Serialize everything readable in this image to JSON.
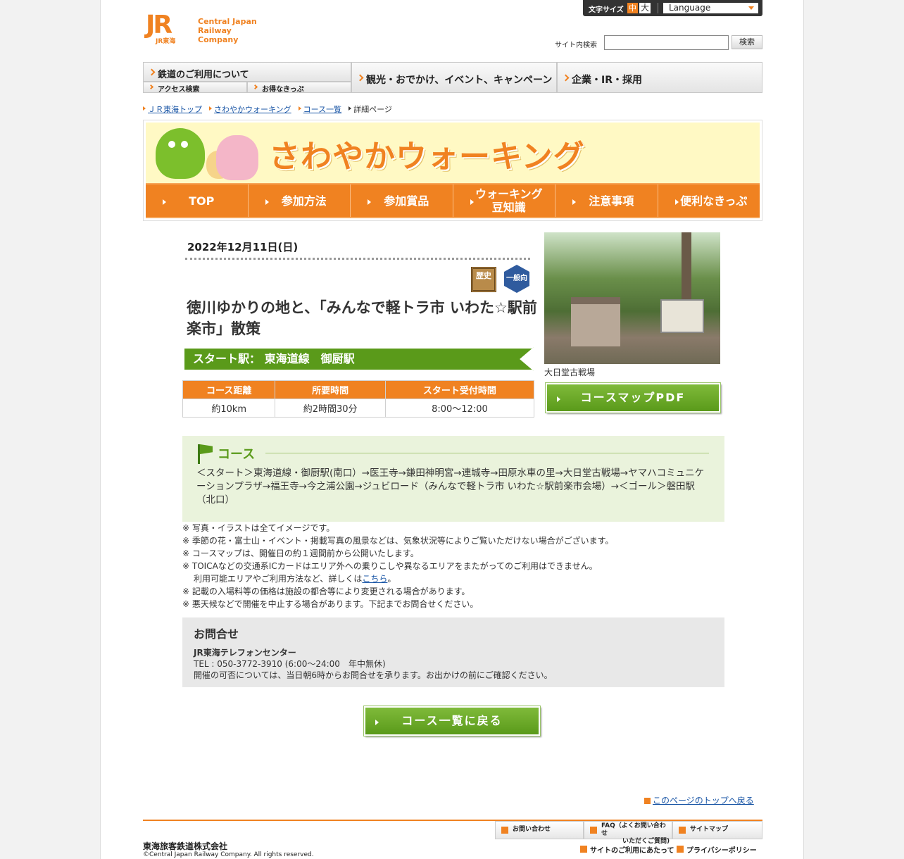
{
  "header": {
    "company_en_line1": "Central Japan",
    "company_en_line2": "Railway Company",
    "logo_mark": "JR",
    "logo_sub": "JR東海",
    "font_size_label": "文字サイズ",
    "font_medium": "中",
    "font_large": "大",
    "language_label": "Language",
    "search_label": "サイト内検索",
    "search_button": "検索",
    "search_value": ""
  },
  "global_nav": {
    "railway": "鉄道のご利用について",
    "access": "アクセス検索",
    "tickets": "お得なきっぷ",
    "tourism": "観光・おでかけ、イベント、キャンペーン",
    "corporate": "企業・IR・採用"
  },
  "breadcrumb": [
    "ＪＲ東海トップ",
    "さわやかウォーキング",
    "コース一覧",
    "詳細ページ"
  ],
  "banner": {
    "title": "さわやかウォーキング",
    "nav": [
      "TOP",
      "参加方法",
      "参加賞品",
      "ウォーキング\n豆知識",
      "注意事項",
      "便利なきっぷ"
    ]
  },
  "event": {
    "date": "2022年12月11日(日)",
    "icon_history": "歴史",
    "icon_general": "一般向",
    "title": "徳川ゆかりの地と、「みんなで軽トラ市 いわた☆駅前楽市」散策",
    "start_station": "スタート駅： 東海道線　御厨駅",
    "table_headers": [
      "コース距離",
      "所要時間",
      "スタート受付時間"
    ],
    "table_values": [
      "約10km",
      "約2時間30分",
      "8:00～12:00"
    ],
    "photo_caption": "大日堂古戦場",
    "map_button": "コースマップPDF"
  },
  "course": {
    "heading": "コース",
    "description": "＜スタート＞東海道線・御厨駅(南口）→医王寺→鎌田神明宮→連城寺→田原水車の里→大日堂古戦場→ヤマハコミュニケーションプラザ→福王寺→今之浦公園→ジュビロード（みんなで軽トラ市 いわた☆駅前楽市会場）→＜ゴール＞磐田駅（北口）"
  },
  "notes": {
    "n1": "※ 写真・イラストは全てイメージです。",
    "n2": "※ 季節の花・富士山・イベント・掲載写真の風景などは、気象状況等によりご覧いただけない場合がございます。",
    "n3": "※ コースマップは、開催日の約１週間前から公開いたします。",
    "n4": "※ TOICAなどの交通系ICカードはエリア外への乗りこしや異なるエリアをまたがってのご利用はできません。",
    "n4b_pre": "利用可能エリアやご利用方法など、詳しくは",
    "n4b_link": "こちら",
    "n4b_post": "。",
    "n5": "※ 記載の入場料等の価格は施設の都合等により変更される場合があります。",
    "n6": "※ 悪天候などで開催を中止する場合があります。下記までお問合せください。"
  },
  "contact": {
    "heading": "お問合せ",
    "name": "JR東海テレフォンセンター",
    "tel": "TEL : 050-3772-3910 (6:00～24:00　年中無休)",
    "note": "開催の可否については、当日朝6時からお問合せを承ります。お出かけの前にご確認ください。"
  },
  "back_button": "コース一覧に戻る",
  "footer": {
    "to_top": "このページのトップへ戻る",
    "inquiry": "お問い合わせ",
    "faq_l1": "FAQ（よくお問い合わせ",
    "faq_l2": "いただくご質問)",
    "sitemap": "サイトマップ",
    "terms": "サイトのご利用にあたって",
    "privacy": "プライバシーポリシー",
    "company_jp": "東海旅客鉄道株式会社",
    "copyright": "©Central Japan Railway Company.  All rights reserved."
  },
  "colors": {
    "accent": "#f08221",
    "green": "#5a9a1a",
    "link": "#1a56a6"
  }
}
